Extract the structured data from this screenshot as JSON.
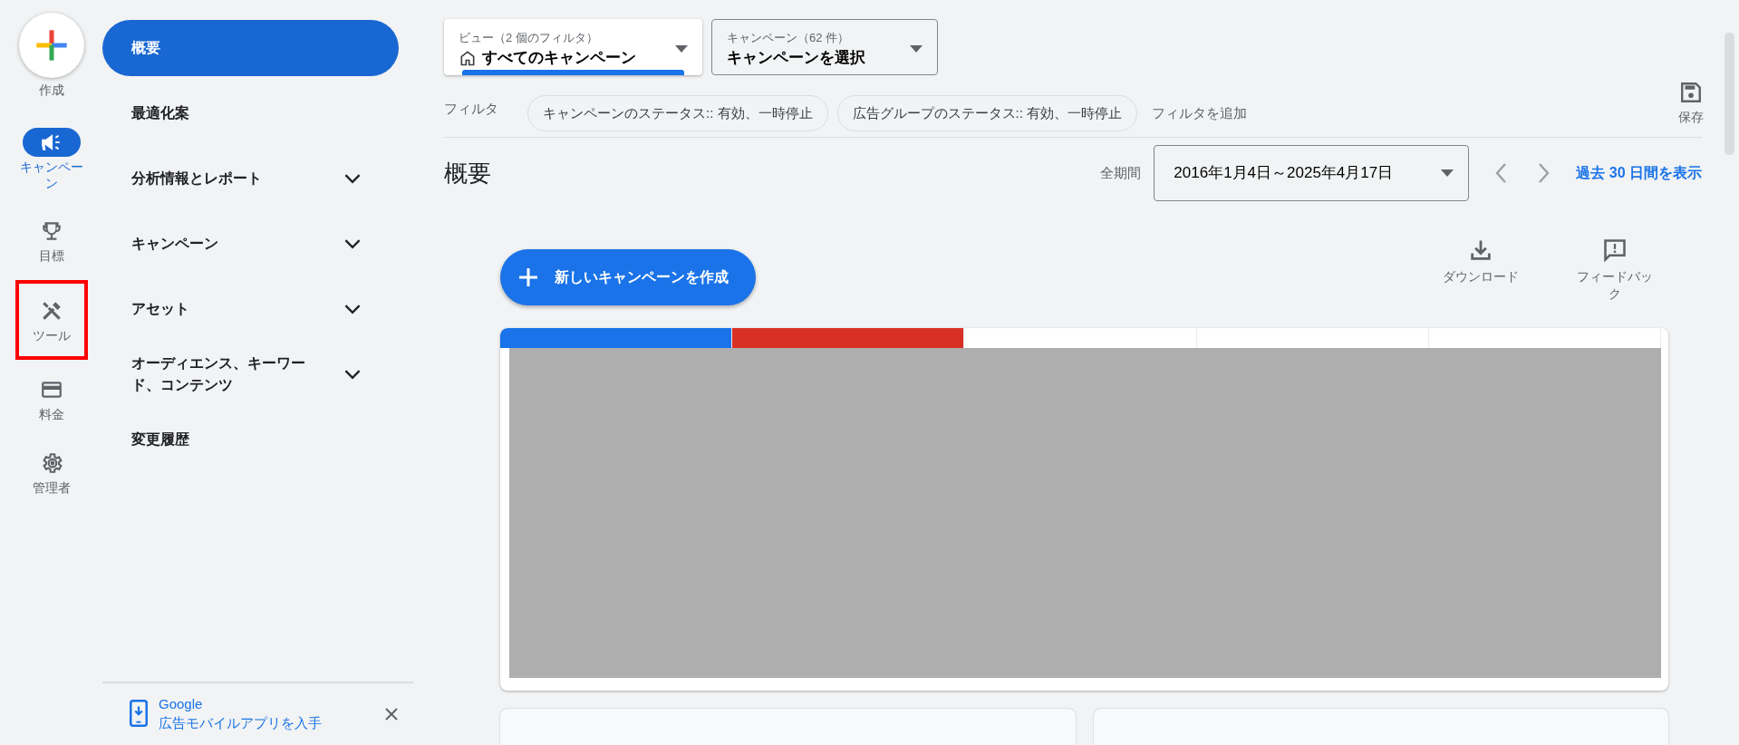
{
  "rail": {
    "create": {
      "label": "作成"
    },
    "items": [
      {
        "label": "キャンペーン",
        "selected": true,
        "highlighted": false
      },
      {
        "label": "目標",
        "selected": false,
        "highlighted": false
      },
      {
        "label": "ツール",
        "selected": false,
        "highlighted": true
      },
      {
        "label": "料金",
        "selected": false,
        "highlighted": false
      },
      {
        "label": "管理者",
        "selected": false,
        "highlighted": false
      }
    ]
  },
  "sidebar": {
    "items": [
      {
        "label": "概要",
        "selected": true,
        "expandable": false
      },
      {
        "label": "最適化案",
        "selected": false,
        "expandable": false
      },
      {
        "label": "分析情報とレポート",
        "selected": false,
        "expandable": true
      },
      {
        "label": "キャンペーン",
        "selected": false,
        "expandable": true
      },
      {
        "label": "アセット",
        "selected": false,
        "expandable": true
      },
      {
        "label": "オーディエンス、キーワード、コンテンツ",
        "selected": false,
        "expandable": true
      },
      {
        "label": "変更履歴",
        "selected": false,
        "expandable": false
      }
    ],
    "promo": {
      "title": "Google",
      "text": "広告モバイルアプリを入手"
    }
  },
  "toolbar": {
    "view_selector": {
      "label": "ビュー（2 個のフィルタ）",
      "value": "すべてのキャンペーン"
    },
    "campaign_selector": {
      "label": "キャンペーン（62 件）",
      "value": "キャンペーンを選択"
    },
    "filter_label": "フィルタ",
    "filters": [
      "キャンペーンのステータス:: 有効、一時停止",
      "広告グループのステータス:: 有効、一時停止"
    ],
    "add_filter": "フィルタを追加",
    "save": "保存"
  },
  "header": {
    "title": "概要",
    "period_label": "全期間",
    "date_range": "2016年1月4日～2025年4月17日",
    "recent_link": "過去 30 日間を表示"
  },
  "new_campaign_button": "新しいキャンペーンを作成",
  "actions": [
    {
      "label": "ダウンロード"
    },
    {
      "label": "フィードバック"
    }
  ],
  "chart_tabs": [
    {
      "selected": true,
      "color": "#1a73e8"
    },
    {
      "selected": true,
      "color": "#d93025"
    },
    {
      "selected": false
    },
    {
      "selected": false
    },
    {
      "selected": false
    }
  ]
}
